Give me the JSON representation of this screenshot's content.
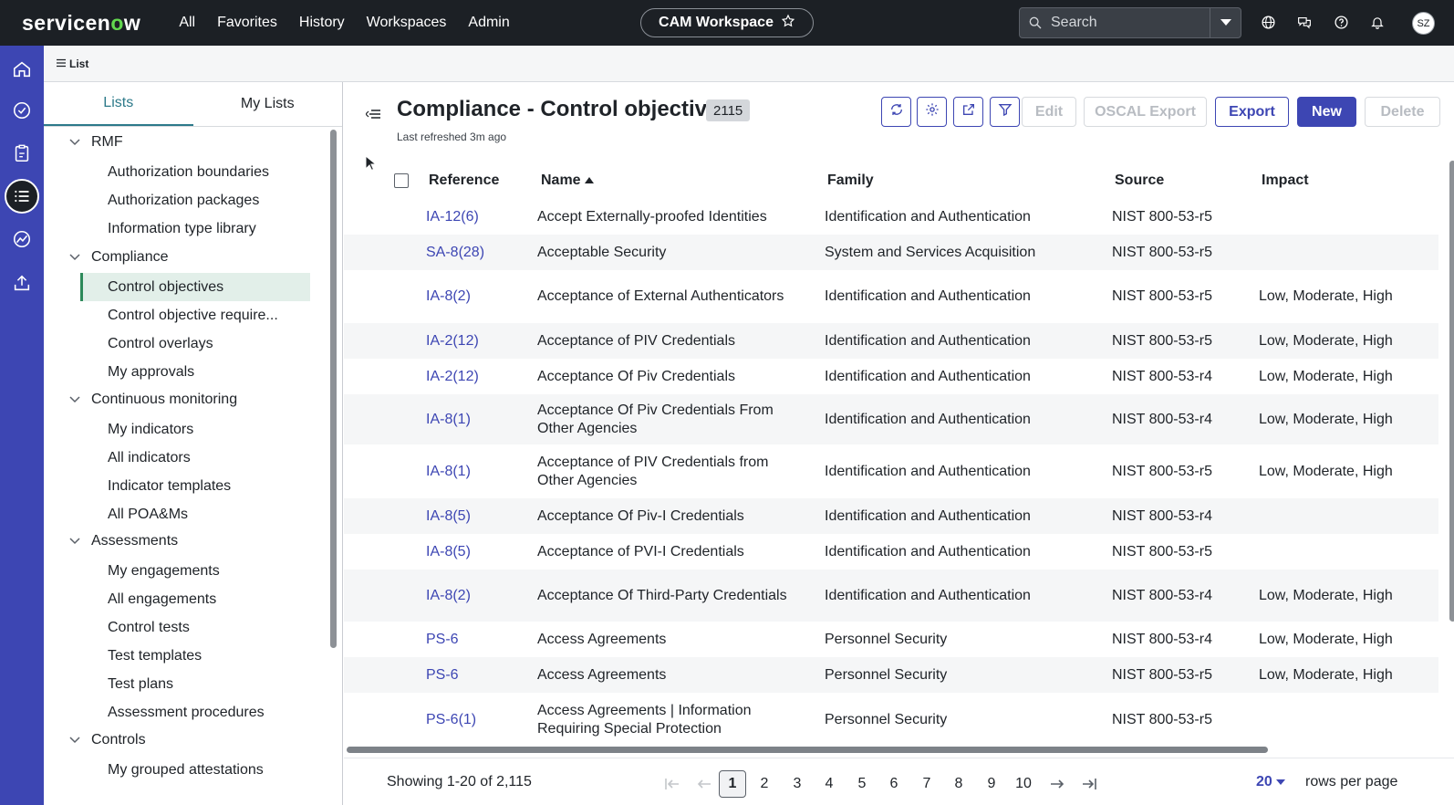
{
  "topnav": {
    "logo_pre": "servicen",
    "logo_o": "o",
    "logo_post": "w",
    "links": [
      "All",
      "Favorites",
      "History",
      "Workspaces",
      "Admin"
    ],
    "workspace": "CAM Workspace",
    "search_placeholder": "Search",
    "avatar_initials": "SZ"
  },
  "subheader": {
    "tab_label": "List"
  },
  "sidepanel": {
    "tabs": [
      "Lists",
      "My Lists"
    ],
    "sections": [
      {
        "label": "RMF",
        "items": [
          "Authorization boundaries",
          "Authorization packages",
          "Information type library"
        ]
      },
      {
        "label": "Compliance",
        "items": [
          "Control objectives",
          "Control objective require...",
          "Control overlays",
          "My approvals"
        ]
      },
      {
        "label": "Continuous monitoring",
        "items": [
          "My indicators",
          "All indicators",
          "Indicator templates",
          "All POA&Ms"
        ]
      },
      {
        "label": "Assessments",
        "items": [
          "My engagements",
          "All engagements",
          "Control tests",
          "Test templates",
          "Test plans",
          "Assessment procedures"
        ]
      },
      {
        "label": "Controls",
        "items": [
          "My grouped attestations"
        ]
      }
    ],
    "active_item": "Control objectives"
  },
  "main": {
    "title": "Compliance - Control objectives",
    "count": "2115",
    "refreshed": "Last refreshed 3m ago",
    "buttons": {
      "edit": "Edit",
      "oscal": "OSCAL Export",
      "export": "Export",
      "new": "New",
      "delete": "Delete"
    },
    "columns": {
      "reference": "Reference",
      "name": "Name",
      "family": "Family",
      "source": "Source",
      "impact": "Impact"
    },
    "rows": [
      {
        "ref": "IA-12(6)",
        "name": "Accept Externally-proofed Identities",
        "family": "Identification and Authentication",
        "source": "NIST 800-53-r5",
        "impact": ""
      },
      {
        "ref": "SA-8(28)",
        "name": "Acceptable Security",
        "family": "System and Services Acquisition",
        "source": "NIST 800-53-r5",
        "impact": ""
      },
      {
        "ref": "IA-8(2)",
        "name": "Acceptance of External Authenticators",
        "family": "Identification and Authentication",
        "source": "NIST 800-53-r5",
        "impact": "Low, Moderate, High"
      },
      {
        "ref": "IA-2(12)",
        "name": "Acceptance of PIV Credentials",
        "family": "Identification and Authentication",
        "source": "NIST 800-53-r5",
        "impact": "Low, Moderate, High"
      },
      {
        "ref": "IA-2(12)",
        "name": "Acceptance Of Piv Credentials",
        "family": "Identification and Authentication",
        "source": "NIST 800-53-r4",
        "impact": "Low, Moderate, High"
      },
      {
        "ref": "IA-8(1)",
        "name": "Acceptance Of Piv Credentials From Other Agencies",
        "family": "Identification and Authentication",
        "source": "NIST 800-53-r4",
        "impact": "Low, Moderate, High"
      },
      {
        "ref": "IA-8(1)",
        "name": "Acceptance of PIV Credentials from Other Agencies",
        "family": "Identification and Authentication",
        "source": "NIST 800-53-r5",
        "impact": "Low, Moderate, High"
      },
      {
        "ref": "IA-8(5)",
        "name": "Acceptance Of Piv-I Credentials",
        "family": "Identification and Authentication",
        "source": "NIST 800-53-r4",
        "impact": ""
      },
      {
        "ref": "IA-8(5)",
        "name": "Acceptance of PVI-I Credentials",
        "family": "Identification and Authentication",
        "source": "NIST 800-53-r5",
        "impact": ""
      },
      {
        "ref": "IA-8(2)",
        "name": "Acceptance Of Third-Party Credentials",
        "family": "Identification and Authentication",
        "source": "NIST 800-53-r4",
        "impact": "Low, Moderate, High"
      },
      {
        "ref": "PS-6",
        "name": "Access Agreements",
        "family": "Personnel Security",
        "source": "NIST 800-53-r4",
        "impact": "Low, Moderate, High"
      },
      {
        "ref": "PS-6",
        "name": "Access Agreements",
        "family": "Personnel Security",
        "source": "NIST 800-53-r5",
        "impact": "Low, Moderate, High"
      },
      {
        "ref": "PS-6(1)",
        "name": "Access Agreements | Information Requiring Special Protection",
        "family": "Personnel Security",
        "source": "NIST 800-53-r5",
        "impact": ""
      }
    ],
    "pagination": {
      "showing": "Showing 1-20 of 2,115",
      "pages": [
        "1",
        "2",
        "3",
        "4",
        "5",
        "6",
        "7",
        "8",
        "9",
        "10"
      ],
      "current": "1",
      "rows_per_page": "20",
      "rows_per_page_label": "rows per page"
    }
  },
  "colors": {
    "accent": "#3d46b3",
    "nav_bg": "#1c2025",
    "active_tab": "#2d7a8a",
    "active_row": "#e2efe9"
  }
}
